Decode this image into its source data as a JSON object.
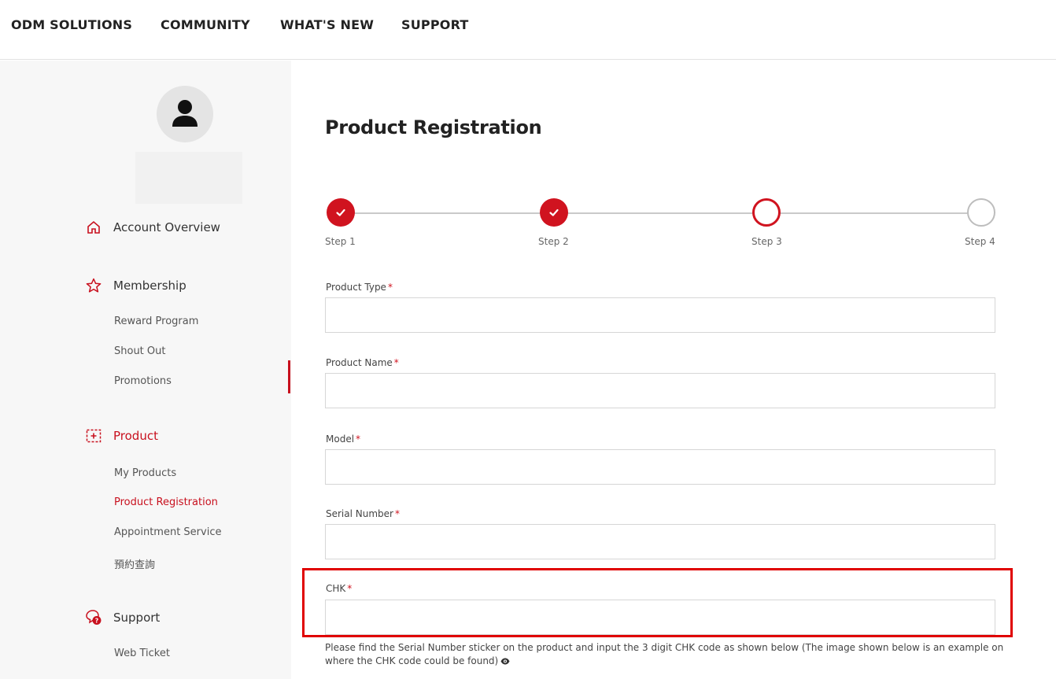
{
  "topnav": {
    "items": [
      "ODM SOLUTIONS",
      "COMMUNITY",
      "WHAT'S NEW",
      "SUPPORT"
    ]
  },
  "sidebar": {
    "sections": [
      {
        "label": "Account Overview",
        "icon": "home-icon"
      },
      {
        "label": "Membership",
        "icon": "star-icon",
        "items": [
          "Reward Program",
          "Shout Out",
          "Promotions"
        ]
      },
      {
        "label": "Product",
        "icon": "product-icon",
        "active": true,
        "items": [
          "My Products",
          "Product Registration",
          "Appointment Service",
          "預約查詢"
        ],
        "active_item": "Product Registration"
      },
      {
        "label": "Support",
        "icon": "support-chat-icon",
        "items": [
          "Web Ticket"
        ]
      }
    ]
  },
  "main": {
    "title": "Product Registration",
    "stepper": {
      "steps": [
        "Step 1",
        "Step 2",
        "Step 3",
        "Step 4"
      ],
      "states": [
        "done",
        "done",
        "current",
        "todo"
      ]
    },
    "fields": [
      {
        "label": "Product Type",
        "required": true,
        "value": ""
      },
      {
        "label": "Product Name",
        "required": true,
        "value": ""
      },
      {
        "label": "Model",
        "required": true,
        "value": ""
      },
      {
        "label": "Serial Number",
        "required": true,
        "value": ""
      },
      {
        "label": "CHK",
        "required": true,
        "value": ""
      }
    ],
    "required_mark": "*",
    "help_text": "Please find the Serial Number sticker on the product and input the 3 digit CHK code as shown below (The image shown below is an example on where the CHK code could be found)"
  },
  "colors": {
    "accent": "#d0131f",
    "highlight": "#e00000",
    "sidebar_bg": "#f7f7f7"
  }
}
